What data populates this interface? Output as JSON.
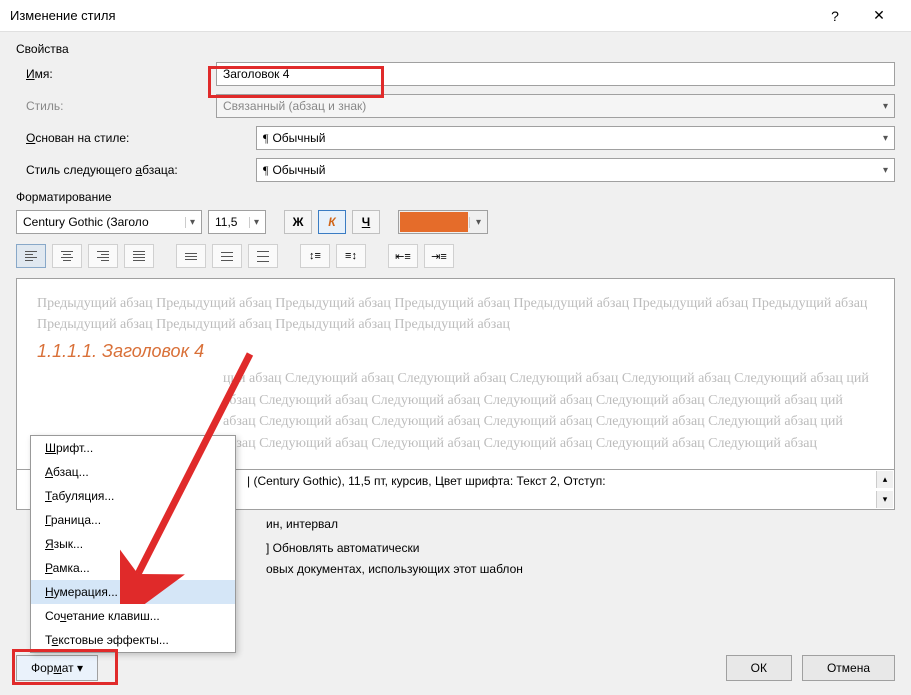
{
  "titlebar": {
    "title": "Изменение стиля"
  },
  "properties": {
    "section": "Свойства",
    "name_label_pre": "",
    "name_label_u": "И",
    "name_label_post": "мя:",
    "name_value": "Заголовок 4",
    "type_label": "Стиль:",
    "type_value": "Связанный (абзац и знак)",
    "based_label_pre": "",
    "based_label_u": "О",
    "based_label_post": "снован на стиле:",
    "based_value": "Обычный",
    "next_label_pre": "Стиль следующего ",
    "next_label_u": "а",
    "next_label_post": "бзаца:",
    "next_value": "Обычный"
  },
  "formatting": {
    "section": "Форматирование",
    "font": "Century Gothic (Заголо",
    "size": "11,5",
    "bold": "Ж",
    "italic": "К",
    "underline": "Ч",
    "color": "#e56c2a"
  },
  "preview": {
    "prev": "Предыдущий абзац Предыдущий абзац Предыдущий абзац Предыдущий абзац Предыдущий абзац Предыдущий абзац Предыдущий абзац Предыдущий абзац Предыдущий абзац Предыдущий абзац Предыдущий абзац",
    "sample": "1.1.1.1. Заголовок 4",
    "next": "ций абзац Следующий абзац Следующий абзац Следующий абзац Следующий абзац Следующий абзац ций абзац Следующий абзац Следующий абзац Следующий абзац Следующий абзац Следующий абзац ций абзац Следующий абзац Следующий абзац Следующий абзац Следующий абзац Следующий абзац ций абзац Следующий абзац Следующий абзац Следующий абзац Следующий абзац Следующий абзац"
  },
  "description": {
    "line1": "| (Century Gothic), 11,5 пт, курсив, Цвет шрифта: Текст 2, Отступ:",
    "line2": "ин, интервал"
  },
  "checks": {
    "update": "Обновлять автоматически",
    "scope": "овых документах, использующих этот шаблон"
  },
  "format_btn_pre": "Фор",
  "format_btn_u": "м",
  "format_btn_post": "ат",
  "buttons": {
    "ok": "ОК",
    "cancel": "Отмена"
  },
  "menu": {
    "font_pre": "",
    "font_u": "Ш",
    "font_post": "рифт...",
    "para_pre": "",
    "para_u": "А",
    "para_post": "бзац...",
    "tabs_pre": "",
    "tabs_u": "Т",
    "tabs_post": "абуляция...",
    "border_pre": "",
    "border_u": "Г",
    "border_post": "раница...",
    "lang_pre": "",
    "lang_u": "Я",
    "lang_post": "зык...",
    "frame_pre": "",
    "frame_u": "Р",
    "frame_post": "амка...",
    "num_pre": "",
    "num_u": "Н",
    "num_post": "умерация...",
    "key_pre": "Со",
    "key_u": "ч",
    "key_post": "етание клавиш...",
    "fx_pre": "Т",
    "fx_u": "е",
    "fx_post": "кстовые эффекты..."
  }
}
